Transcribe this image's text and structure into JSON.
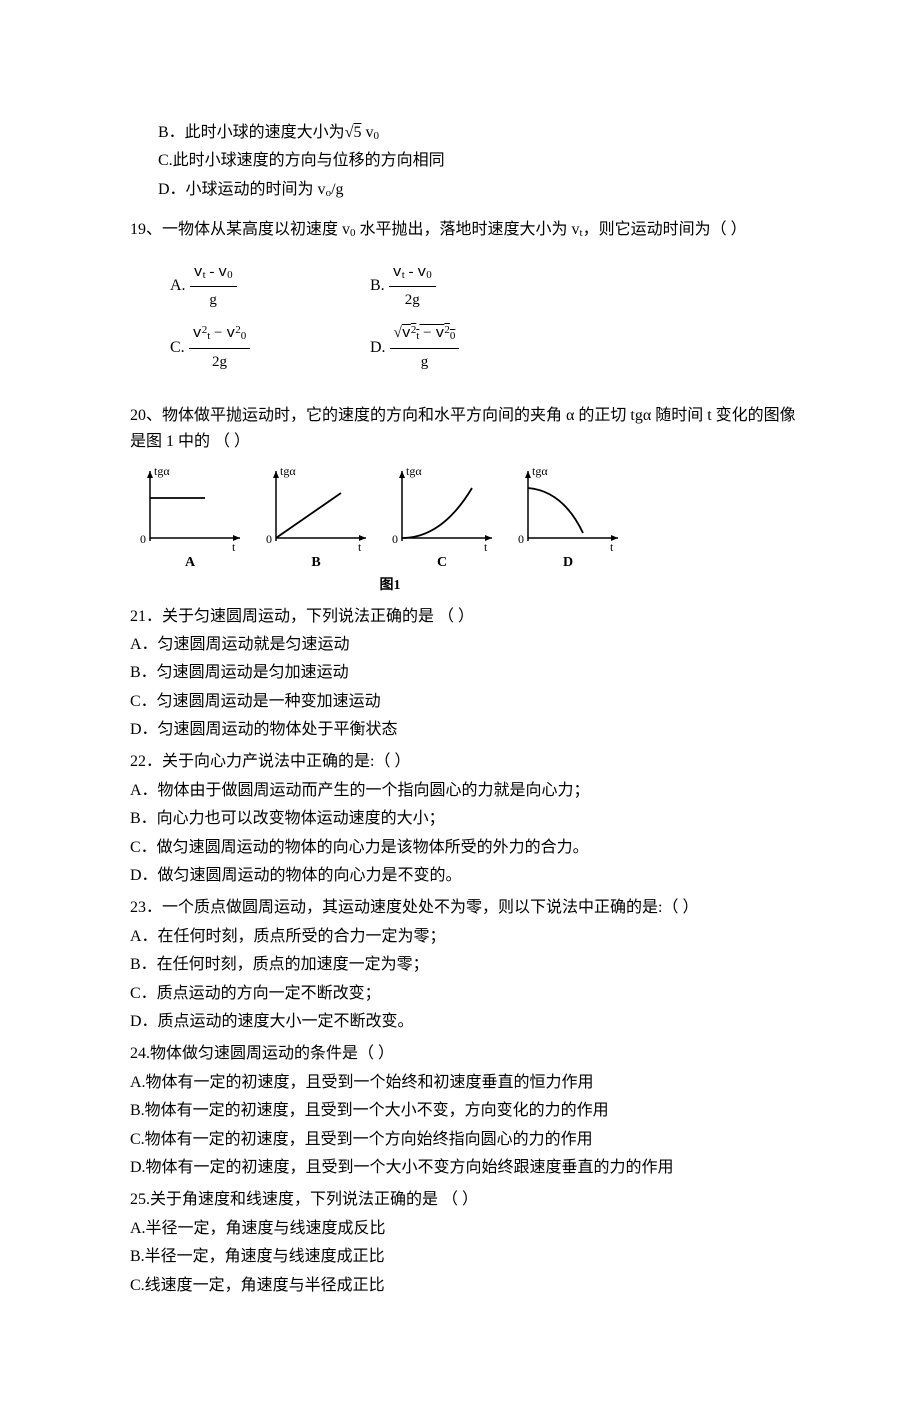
{
  "q18": {
    "b": "B．此时小球的速度大小为",
    "b_tail": " v",
    "b_sub": "0",
    "sqrt5": "5",
    "c": "C.此时小球速度的方向与位移的方向相同",
    "d": "D．小球运动的时间为 v",
    "d_sub": "o",
    "d_tail": "/g"
  },
  "q19": {
    "stem": "19、一物体从某高度以初速度 v",
    "sub0": "0",
    "mid": " 水平抛出，落地时速度大小为 v",
    "subt": "t",
    "tail": "，则它运动时间为（        ）",
    "A": {
      "label": "A.",
      "num": "v t - v 0",
      "den": "g"
    },
    "B": {
      "label": "B.",
      "num": "v t - v 0",
      "den": "2g"
    },
    "C": {
      "label": "C.",
      "num_a": "v",
      "num_a_sup": "2",
      "num_a_sub": "t",
      "num_b": "v",
      "num_b_sup": "2",
      "num_b_sub": "0",
      "den": "2g"
    },
    "D": {
      "label": "D.",
      "num_a": "v",
      "num_a_sup": "2",
      "num_a_sub": "t",
      "num_b": "v",
      "num_b_sup": "2",
      "num_b_sub": "0",
      "den": "g"
    }
  },
  "q20": {
    "stem": "20、物体做平抛运动时，它的速度的方向和水平方向间的夹角 α 的正切 tgα 随时间 t 变化的图像是图 1 中的 （        ）",
    "axis_y": "tgα",
    "axis_x": "t",
    "origin": "0",
    "labels": {
      "A": "A",
      "B": "B",
      "C": "C",
      "D": "D"
    },
    "caption": "图1",
    "chart_data": [
      {
        "type": "line",
        "name": "A",
        "xlabel": "t",
        "ylabel": "tgα",
        "description": "constant positive value (horizontal line above axis)"
      },
      {
        "type": "line",
        "name": "B",
        "xlabel": "t",
        "ylabel": "tgα",
        "description": "straight line through origin, positive slope (linear increase)"
      },
      {
        "type": "line",
        "name": "C",
        "xlabel": "t",
        "ylabel": "tgα",
        "description": "concave-up curve starting at origin (increasing, slope increasing)"
      },
      {
        "type": "line",
        "name": "D",
        "xlabel": "t",
        "ylabel": "tgα",
        "description": "concave-down curve starting high on y-axis, decreasing toward t-axis"
      }
    ]
  },
  "q21": {
    "stem": "21．关于匀速圆周运动，下列说法正确的是 （        ）",
    "A": "A．匀速圆周运动就是匀速运动",
    "B": "B．匀速圆周运动是匀加速运动",
    "C": "C．匀速圆周运动是一种变加速运动",
    "D": "D．匀速圆周运动的物体处于平衡状态"
  },
  "q22": {
    "stem": "22．关于向心力产说法中正确的是:（        ）",
    "A": "A．物体由于做圆周运动而产生的一个指向圆心的力就是向心力；",
    "B": "B．向心力也可以改变物体运动速度的大小；",
    "C": "C．做匀速圆周运动的物体的向心力是该物体所受的外力的合力。",
    "D": "D．做匀速圆周运动的物体的向心力是不变的。"
  },
  "q23": {
    "stem": "23．一个质点做圆周运动，其运动速度处处不为零，则以下说法中正确的是:（       ）",
    "A": "A．在任何时刻，质点所受的合力一定为零；",
    "B": "B．在任何时刻，质点的加速度一定为零；",
    "C": "C．质点运动的方向一定不断改变；",
    "D": "D．质点运动的速度大小一定不断改变。"
  },
  "q24": {
    "stem": "24.物体做匀速圆周运动的条件是（         ）",
    "A": "A.物体有一定的初速度，且受到一个始终和初速度垂直的恒力作用",
    "B": "B.物体有一定的初速度，且受到一个大小不变，方向变化的力的作用",
    "C": "C.物体有一定的初速度，且受到一个方向始终指向圆心的力的作用",
    "D": "D.物体有一定的初速度，且受到一个大小不变方向始终跟速度垂直的力的作用"
  },
  "q25": {
    "stem": "25.关于角速度和线速度，下列说法正确的是 （       ）",
    "A": "A.半径一定，角速度与线速度成反比",
    "B": "B.半径一定，角速度与线速度成正比",
    "C": "C.线速度一定，角速度与半径成正比"
  }
}
